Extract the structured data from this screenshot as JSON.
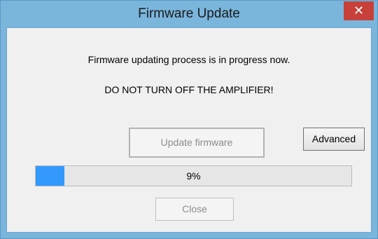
{
  "window": {
    "title": "Firmware Update",
    "close_glyph": "✕"
  },
  "messages": {
    "line1": "Firmware updating process is in progress now.",
    "line2": "DO NOT TURN OFF THE AMPLIFIER!"
  },
  "buttons": {
    "update_label": "Update firmware",
    "update_enabled": false,
    "advanced_label": "Advanced",
    "close_label": "Close",
    "close_enabled": false
  },
  "progress": {
    "value": 0.09,
    "text": "9%"
  },
  "colors": {
    "titlebar": "#7ab5dc",
    "close_button": "#c7413a",
    "progress_fill": "#3399ff",
    "client_bg": "#f0f0f0"
  }
}
